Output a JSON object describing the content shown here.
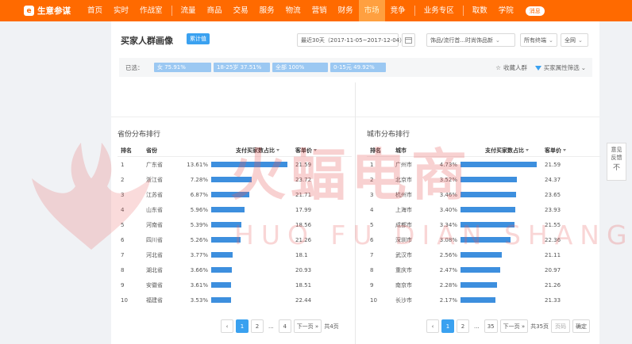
{
  "nav": {
    "logo_mark": "e",
    "logo_text": "生意参谋",
    "items": [
      "首页",
      "实时",
      "作战室",
      "流量",
      "商品",
      "交易",
      "服务",
      "物流",
      "营销",
      "财务",
      "市场",
      "竞争",
      "业务专区",
      "取数",
      "学院"
    ],
    "active": "市场",
    "message": "消息"
  },
  "header": {
    "title": "买家人群画像",
    "badge": "累计值",
    "date_range": "最近30天（2017-11-05~2017-12-04）",
    "category": "饰品/流行首...时尚饰品新",
    "terminal": "所有终端",
    "region": "全网"
  },
  "filter": {
    "label": "已选：",
    "chips": [
      "女 75.91%",
      "18-25岁 37.51%",
      "全部 100%",
      "0-15元 49.92%"
    ],
    "favorite": "收藏人群",
    "attr_filter": "买家属性筛选"
  },
  "provinces": {
    "title": "省份分布排行",
    "headers": {
      "rank": "排名",
      "name": "省份",
      "pct": "支付买家数占比",
      "price": "客单价"
    },
    "rows": [
      {
        "rank": "1",
        "name": "广东省",
        "pct": "13.61%",
        "price": "21.59",
        "ratio": 13.61
      },
      {
        "rank": "2",
        "name": "浙江省",
        "pct": "7.28%",
        "price": "23.72",
        "ratio": 7.28
      },
      {
        "rank": "3",
        "name": "江苏省",
        "pct": "6.87%",
        "price": "21.71",
        "ratio": 6.87
      },
      {
        "rank": "4",
        "name": "山东省",
        "pct": "5.96%",
        "price": "17.99",
        "ratio": 5.96
      },
      {
        "rank": "5",
        "name": "河南省",
        "pct": "5.39%",
        "price": "18.56",
        "ratio": 5.39
      },
      {
        "rank": "6",
        "name": "四川省",
        "pct": "5.26%",
        "price": "21.26",
        "ratio": 5.26
      },
      {
        "rank": "7",
        "name": "河北省",
        "pct": "3.77%",
        "price": "18.1",
        "ratio": 3.77
      },
      {
        "rank": "8",
        "name": "湖北省",
        "pct": "3.66%",
        "price": "20.93",
        "ratio": 3.66
      },
      {
        "rank": "9",
        "name": "安徽省",
        "pct": "3.61%",
        "price": "18.51",
        "ratio": 3.61
      },
      {
        "rank": "10",
        "name": "福建省",
        "pct": "3.53%",
        "price": "22.44",
        "ratio": 3.53
      }
    ],
    "pager": {
      "pages": [
        "1",
        "2",
        "...",
        "4"
      ],
      "active": "1",
      "next": "下一页 »",
      "total": "共4页"
    }
  },
  "cities": {
    "title": "城市分布排行",
    "headers": {
      "rank": "排名",
      "name": "城市",
      "pct": "支付买家数占比",
      "price": "客单价"
    },
    "rows": [
      {
        "rank": "1",
        "name": "广州市",
        "pct": "4.73%",
        "price": "21.59",
        "ratio": 4.73
      },
      {
        "rank": "2",
        "name": "北京市",
        "pct": "3.52%",
        "price": "24.37",
        "ratio": 3.52
      },
      {
        "rank": "3",
        "name": "杭州市",
        "pct": "3.46%",
        "price": "23.65",
        "ratio": 3.46
      },
      {
        "rank": "4",
        "name": "上海市",
        "pct": "3.40%",
        "price": "23.93",
        "ratio": 3.4
      },
      {
        "rank": "5",
        "name": "成都市",
        "pct": "3.34%",
        "price": "21.55",
        "ratio": 3.34
      },
      {
        "rank": "6",
        "name": "深圳市",
        "pct": "3.08%",
        "price": "22.36",
        "ratio": 3.08
      },
      {
        "rank": "7",
        "name": "武汉市",
        "pct": "2.56%",
        "price": "21.11",
        "ratio": 2.56
      },
      {
        "rank": "8",
        "name": "重庆市",
        "pct": "2.47%",
        "price": "20.97",
        "ratio": 2.47
      },
      {
        "rank": "9",
        "name": "南京市",
        "pct": "2.28%",
        "price": "21.26",
        "ratio": 2.28
      },
      {
        "rank": "10",
        "name": "长沙市",
        "pct": "2.17%",
        "price": "21.33",
        "ratio": 2.17
      }
    ],
    "pager": {
      "pages": [
        "1",
        "2",
        "...",
        "35"
      ],
      "active": "1",
      "next": "下一页 »",
      "total": "共35页",
      "goto_placeholder": "页码",
      "confirm": "确定"
    }
  },
  "watermark": {
    "cn": "火蝠电商",
    "en": "HUO FU DIAN SHANG"
  },
  "feedback": {
    "label": "意见反馈",
    "arrow": "不"
  },
  "colors": {
    "brand": "#ff6a00",
    "bar": "#3d8fde",
    "chip": "#9bc8f2",
    "accent": "#3aa1f0"
  }
}
